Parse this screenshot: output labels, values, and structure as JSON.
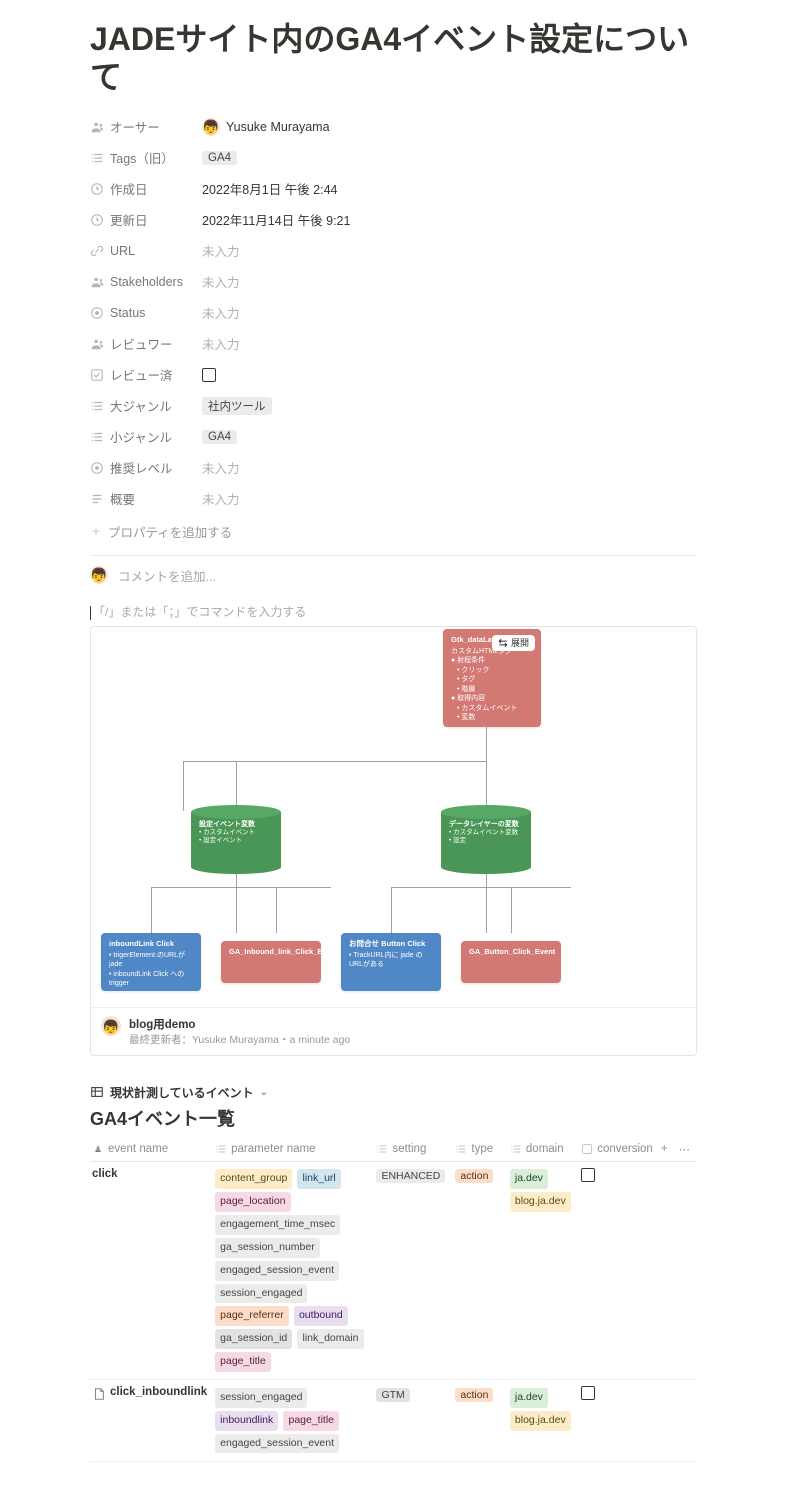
{
  "title": "JADEサイト内のGA4イベント設定について",
  "properties": {
    "owner": {
      "label": "オーサー",
      "name": "Yusuke Murayama"
    },
    "tags": {
      "label": "Tags（旧）",
      "value": "GA4"
    },
    "created": {
      "label": "作成日",
      "value": "2022年8月1日 午後 2:44"
    },
    "updated": {
      "label": "更新日",
      "value": "2022年11月14日 午後 9:21"
    },
    "url": {
      "label": "URL",
      "empty": "未入力"
    },
    "stakeholders": {
      "label": "Stakeholders",
      "empty": "未入力"
    },
    "status": {
      "label": "Status",
      "empty": "未入力"
    },
    "reviewer": {
      "label": "レビュワー",
      "empty": "未入力"
    },
    "reviewed": {
      "label": "レビュー済"
    },
    "category": {
      "label": "大ジャンル",
      "value": "社内ツール"
    },
    "subcategory": {
      "label": "小ジャンル",
      "value": "GA4"
    },
    "recommend": {
      "label": "推奨レベル",
      "empty": "未入力"
    },
    "summary": {
      "label": "概要",
      "empty": "未入力"
    },
    "add": "プロパティを追加する"
  },
  "comment_placeholder": "コメントを追加...",
  "command_hint": "「/」または「；」でコマンドを入力する",
  "embed": {
    "expand": "展開",
    "node_top": {
      "title": "Gtk_dataLayer",
      "sub": "カスタムHTMLタグ",
      "s1": "● 射程条件",
      "l1": "• クリック",
      "l2": "• タグ",
      "l3": "• 階層",
      "s2": "● 取得内容",
      "l4": "• カスタムイベント",
      "l5": "• 変数"
    },
    "cyl_left": {
      "title": "設定イベント変数",
      "l1": "• カスタムイベント",
      "l2": "• 設定イベント"
    },
    "cyl_right": {
      "title": "データレイヤーの変数",
      "l1": "• カスタムイベント変数",
      "l2": "• 設定"
    },
    "node_b1": {
      "title": "inboundLink Click",
      "l1": "• trigerElement.のURLがjade",
      "l2": "• inboundLink Click への trigger"
    },
    "node_b2": {
      "title": "GA_Inbound_link_Click_Event"
    },
    "node_b3": {
      "title": "お問合せ Button Click",
      "l1": "• TrackURL内に jade のURLがある"
    },
    "node_b4": {
      "title": "GA_Button_Click_Event"
    },
    "footer_title": "blog用demo",
    "footer_sub": "最終更新者：Yusuke Murayama・a minute ago"
  },
  "database": {
    "view_name": "現状計測しているイベント",
    "title": "GA4イベント一覧",
    "columns": {
      "event_name": "event name",
      "parameter": "parameter name",
      "setting": "setting",
      "type": "type",
      "domain": "domain",
      "conversion": "conversion"
    },
    "rows": [
      {
        "name": "click",
        "icon": false,
        "params": [
          {
            "t": "content_group",
            "c": "c-yellow"
          },
          {
            "t": "link_url",
            "c": "c-blue"
          },
          {
            "t": "page_location",
            "c": "c-pink"
          },
          {
            "t": "engagement_time_msec",
            "c": "c-default"
          },
          {
            "t": "ga_session_number",
            "c": "c-default"
          },
          {
            "t": "engaged_session_event",
            "c": "c-default"
          },
          {
            "t": "session_engaged",
            "c": "c-default"
          },
          {
            "t": "page_referrer",
            "c": "c-orange"
          },
          {
            "t": "outbound",
            "c": "c-purple"
          },
          {
            "t": "ga_session_id",
            "c": "c-gray"
          },
          {
            "t": "link_domain",
            "c": "c-default"
          },
          {
            "t": "page_title",
            "c": "c-pink"
          }
        ],
        "setting": {
          "t": "ENHANCED",
          "c": "c-default"
        },
        "type": {
          "t": "action",
          "c": "c-orange"
        },
        "domain": [
          {
            "t": "ja.dev",
            "c": "c-green"
          },
          {
            "t": "blog.ja.dev",
            "c": "c-yellow"
          }
        ]
      },
      {
        "name": "click_inboundlink",
        "icon": true,
        "params": [
          {
            "t": "session_engaged",
            "c": "c-default"
          },
          {
            "t": "inboundlink",
            "c": "c-purple"
          },
          {
            "t": "page_title",
            "c": "c-pink"
          },
          {
            "t": "engaged_session_event",
            "c": "c-default"
          }
        ],
        "setting": {
          "t": "GTM",
          "c": "c-gray"
        },
        "type": {
          "t": "action",
          "c": "c-orange"
        },
        "domain": [
          {
            "t": "ja.dev",
            "c": "c-green"
          },
          {
            "t": "blog.ja.dev",
            "c": "c-yellow"
          }
        ]
      }
    ]
  }
}
